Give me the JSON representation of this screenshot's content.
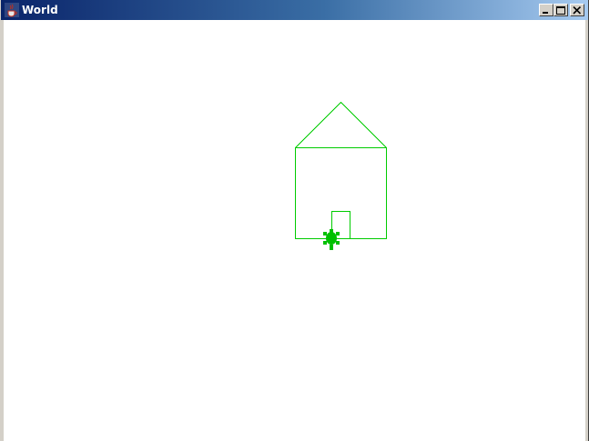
{
  "window": {
    "title": "World",
    "icon": "java-cup-icon"
  },
  "controls": {
    "minimize": "minimize-icon",
    "maximize": "maximize-icon",
    "close": "close-icon"
  },
  "world": {
    "background": "#ffffff",
    "pen_color": "#00cc00",
    "turtle_color": "#00c000",
    "drawing": "house"
  }
}
